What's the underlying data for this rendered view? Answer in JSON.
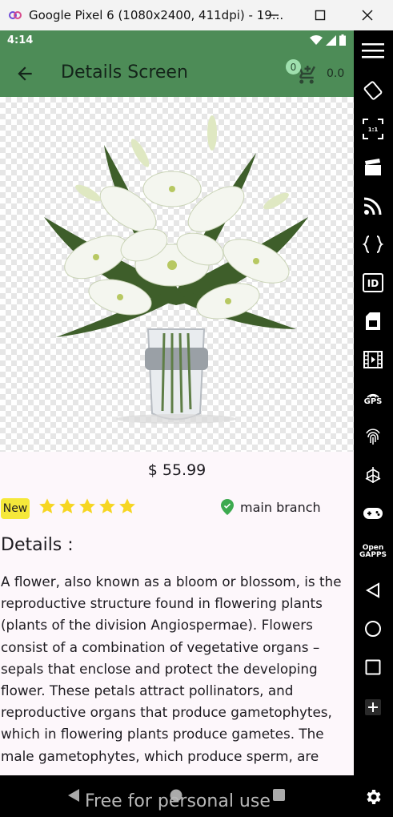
{
  "window": {
    "title": "Google Pixel 6 (1080x2400, 411dpi) - 19..."
  },
  "status_bar": {
    "time": "4:14"
  },
  "app_bar": {
    "title": "Details Screen",
    "cart_count": "0",
    "cart_total": "0.0"
  },
  "product": {
    "price": "$ 55.99",
    "badge": "New",
    "rating": 5,
    "rating_max": 5,
    "branch": "main branch",
    "details_heading": "Details :",
    "description": "A flower, also known as a bloom or blossom, is the reproductive structure found in flowering plants (plants of the division Angiospermae). Flowers consist of a combination of vegetative organs – sepals that enclose and protect the developing flower. These petals attract pollinators, and reproductive organs that produce gametophytes, which in flowering plants produce gametes. The male gametophytes, which produce sperm, are"
  },
  "nav_bar": {
    "watermark": "Free for personal use"
  },
  "side_toolbar": {
    "gps_label": "GPS",
    "id_label": "ID",
    "open_gapps_label": "Open GAPPS",
    "fullscreen_label": "1:1"
  },
  "colors": {
    "app_bar": "#4d8c57",
    "badge_new": "#f5e83a",
    "star": "#f6d622",
    "pin": "#3daa4f"
  }
}
